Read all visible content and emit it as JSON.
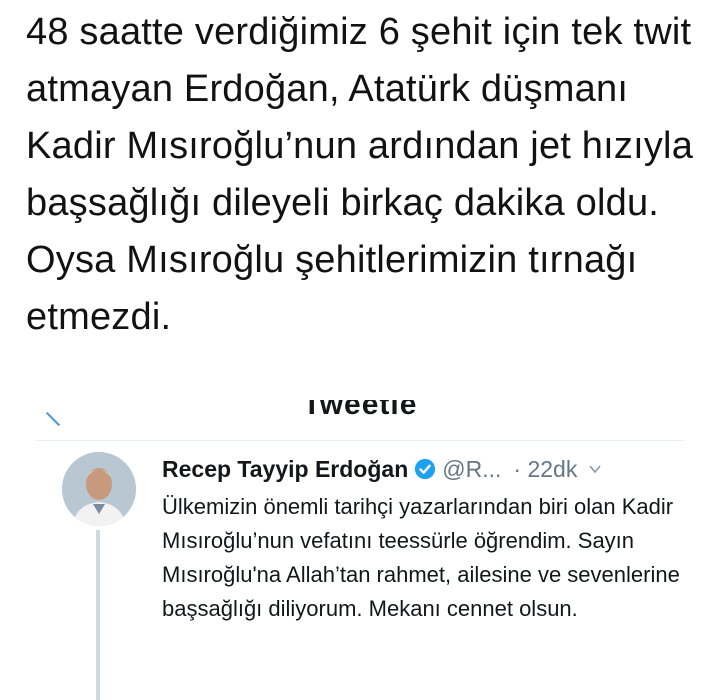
{
  "main": {
    "text": "48 saatte verdiğimiz 6 şehit için tek twit atmayan Erdoğan, Atatürk düşmanı Kadir Mısıroğlu’nun ardından jet hızıyla başsağlığı dileyeli birkaç dakika oldu. Oysa Mısıroğlu şehitlerimizin tırnağı etmezdi."
  },
  "embed": {
    "header_partial": "Tweetle",
    "author_name": "Recep Tayyip Erdoğan",
    "handle": "@R...",
    "time": "· 22dk",
    "tweet_text": "Ülkemizin önemli tarihçi yazarlarından biri olan Kadir Mısıroğlu’nun vefatını teessürle öğrendim. Sayın Mısıroğlu'na Allah’tan rahmet, ailesine ve sevenlerine başsağlığı diliyorum. Mekanı cennet olsun.",
    "accent_color": "#1da1f2"
  }
}
